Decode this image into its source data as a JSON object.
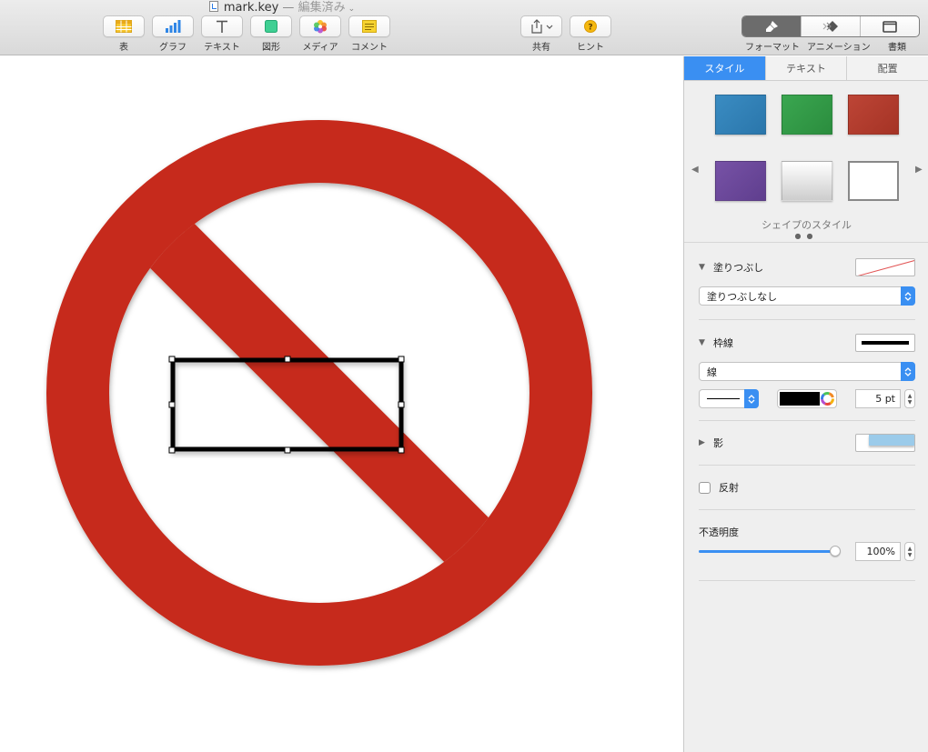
{
  "window": {
    "file_name": "mark.key",
    "separator": "—",
    "status": "編集済み"
  },
  "toolbar": {
    "left_items": [
      {
        "label": "表",
        "icon": "table-icon"
      },
      {
        "label": "グラフ",
        "icon": "chart-icon"
      },
      {
        "label": "テキスト",
        "icon": "text-icon"
      },
      {
        "label": "図形",
        "icon": "shape-icon"
      },
      {
        "label": "メディア",
        "icon": "media-icon"
      },
      {
        "label": "コメント",
        "icon": "comment-icon"
      }
    ],
    "center_items": [
      {
        "label": "共有",
        "icon": "share-icon"
      },
      {
        "label": "ヒント",
        "icon": "tips-icon"
      }
    ],
    "right_items": [
      {
        "label": "フォーマット",
        "icon": "format-brush-icon"
      },
      {
        "label": "アニメーション",
        "icon": "animate-icon"
      },
      {
        "label": "書類",
        "icon": "document-icon"
      }
    ]
  },
  "canvas": {
    "symbol_color": "#c62a1a",
    "selection_border_color": "#000000"
  },
  "inspector": {
    "tabs": [
      {
        "label": "スタイル",
        "active": true
      },
      {
        "label": "テキスト",
        "active": false
      },
      {
        "label": "配置",
        "active": false
      }
    ],
    "shape_styles_label": "シェイプのスタイル",
    "swatch_colors": [
      "#2f82b8",
      "#2f9b45",
      "#b33a2c",
      "#6d4a9c",
      "#e2e2e2",
      "#ffffff"
    ],
    "fill": {
      "title": "塗りつぶし",
      "popup_value": "塗りつぶしなし"
    },
    "border": {
      "title": "枠線",
      "popup_value": "線",
      "color": "#000000",
      "width_value": "5 pt"
    },
    "shadow": {
      "title": "影"
    },
    "reflection": {
      "title": "反射",
      "checked": false
    },
    "opacity": {
      "title": "不透明度",
      "value": "100%",
      "fraction": 1.0
    }
  }
}
